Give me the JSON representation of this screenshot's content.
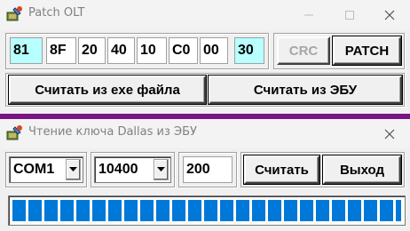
{
  "patch_window": {
    "title": "Patch OLT",
    "hex_bytes": [
      "81",
      "8F",
      "20",
      "40",
      "10",
      "C0",
      "00",
      "30"
    ],
    "crc_label": "CRC",
    "patch_label": "PATCH",
    "read_exe_label": "Считать из exe файла",
    "read_ecu_label": "Считать из ЭБУ"
  },
  "dallas_window": {
    "title": "Чтение ключа Dallas из ЭБУ",
    "port_value": "COM1",
    "baud_value": "10400",
    "timeout_value": "200",
    "read_label": "Считать",
    "exit_label": "Выход",
    "progress": 1.0
  },
  "colors": {
    "accent": "#0078d7",
    "selected_field": "#b8ffff",
    "background": "#7a1585"
  },
  "icons": [
    "app-icon",
    "minimize-icon",
    "maximize-icon",
    "close-icon",
    "dropdown-arrow-icon"
  ]
}
